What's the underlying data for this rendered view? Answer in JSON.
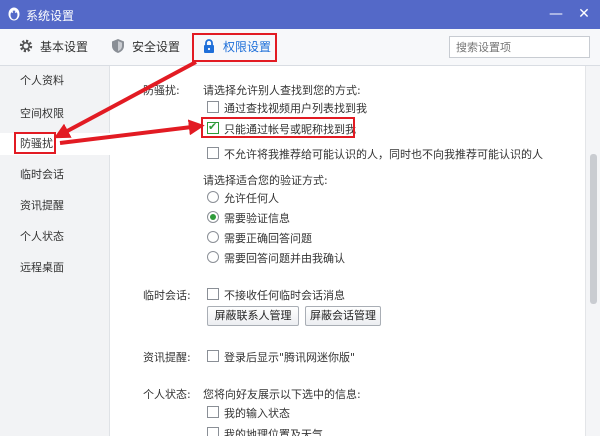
{
  "window": {
    "title": "系统设置",
    "minimize_label": "—",
    "close_label": "✕"
  },
  "toolbar": {
    "tabs": [
      {
        "label": "基本设置",
        "icon": "gear-icon"
      },
      {
        "label": "安全设置",
        "icon": "shield-icon"
      },
      {
        "label": "权限设置",
        "icon": "lock-icon"
      }
    ],
    "active_tab": "权限设置",
    "search_placeholder": "搜索设置项"
  },
  "sidebar": {
    "items": [
      {
        "label": "个人资料"
      },
      {
        "label": "空间权限"
      },
      {
        "label": "防骚扰"
      },
      {
        "label": "临时会话"
      },
      {
        "label": "资讯提醒"
      },
      {
        "label": "个人状态"
      },
      {
        "label": "远程桌面"
      }
    ],
    "active": "防骚扰"
  },
  "anti_harass": {
    "section_label": "防骚扰:",
    "find_prompt": "请选择允许别人查找到您的方式:",
    "find_options": [
      {
        "label": "通过查找视频用户列表找到我",
        "checked": false
      },
      {
        "label": "只能通过帐号或昵称找到我",
        "checked": true
      },
      {
        "label": "不允许将我推荐给可能认识的人，同时也不向我推荐可能认识的人",
        "checked": false
      }
    ],
    "verify_prompt": "请选择适合您的验证方式:",
    "verify_options": [
      {
        "label": "允许任何人",
        "selected": false
      },
      {
        "label": "需要验证信息",
        "selected": true
      },
      {
        "label": "需要正确回答问题",
        "selected": false
      },
      {
        "label": "需要回答问题并由我确认",
        "selected": false
      }
    ]
  },
  "temp_session": {
    "section_label": "临时会话:",
    "option": {
      "label": "不接收任何临时会话消息",
      "checked": false
    },
    "buttons": [
      "屏蔽联系人管理",
      "屏蔽会话管理"
    ]
  },
  "news": {
    "section_label": "资讯提醒:",
    "option": {
      "label": "登录后显示\"腾讯网迷你版\"",
      "checked": false
    }
  },
  "status": {
    "section_label": "个人状态:",
    "prompt": "您将向好友展示以下选中的信息:",
    "options": [
      {
        "label": "我的输入状态",
        "checked": false
      },
      {
        "label": "我的地理位置及天气",
        "checked": false
      }
    ]
  },
  "colors": {
    "titlebar": "#5469c8",
    "accent": "#1e6fd9",
    "highlight": "#e21b23",
    "check": "#2f9b3a"
  }
}
